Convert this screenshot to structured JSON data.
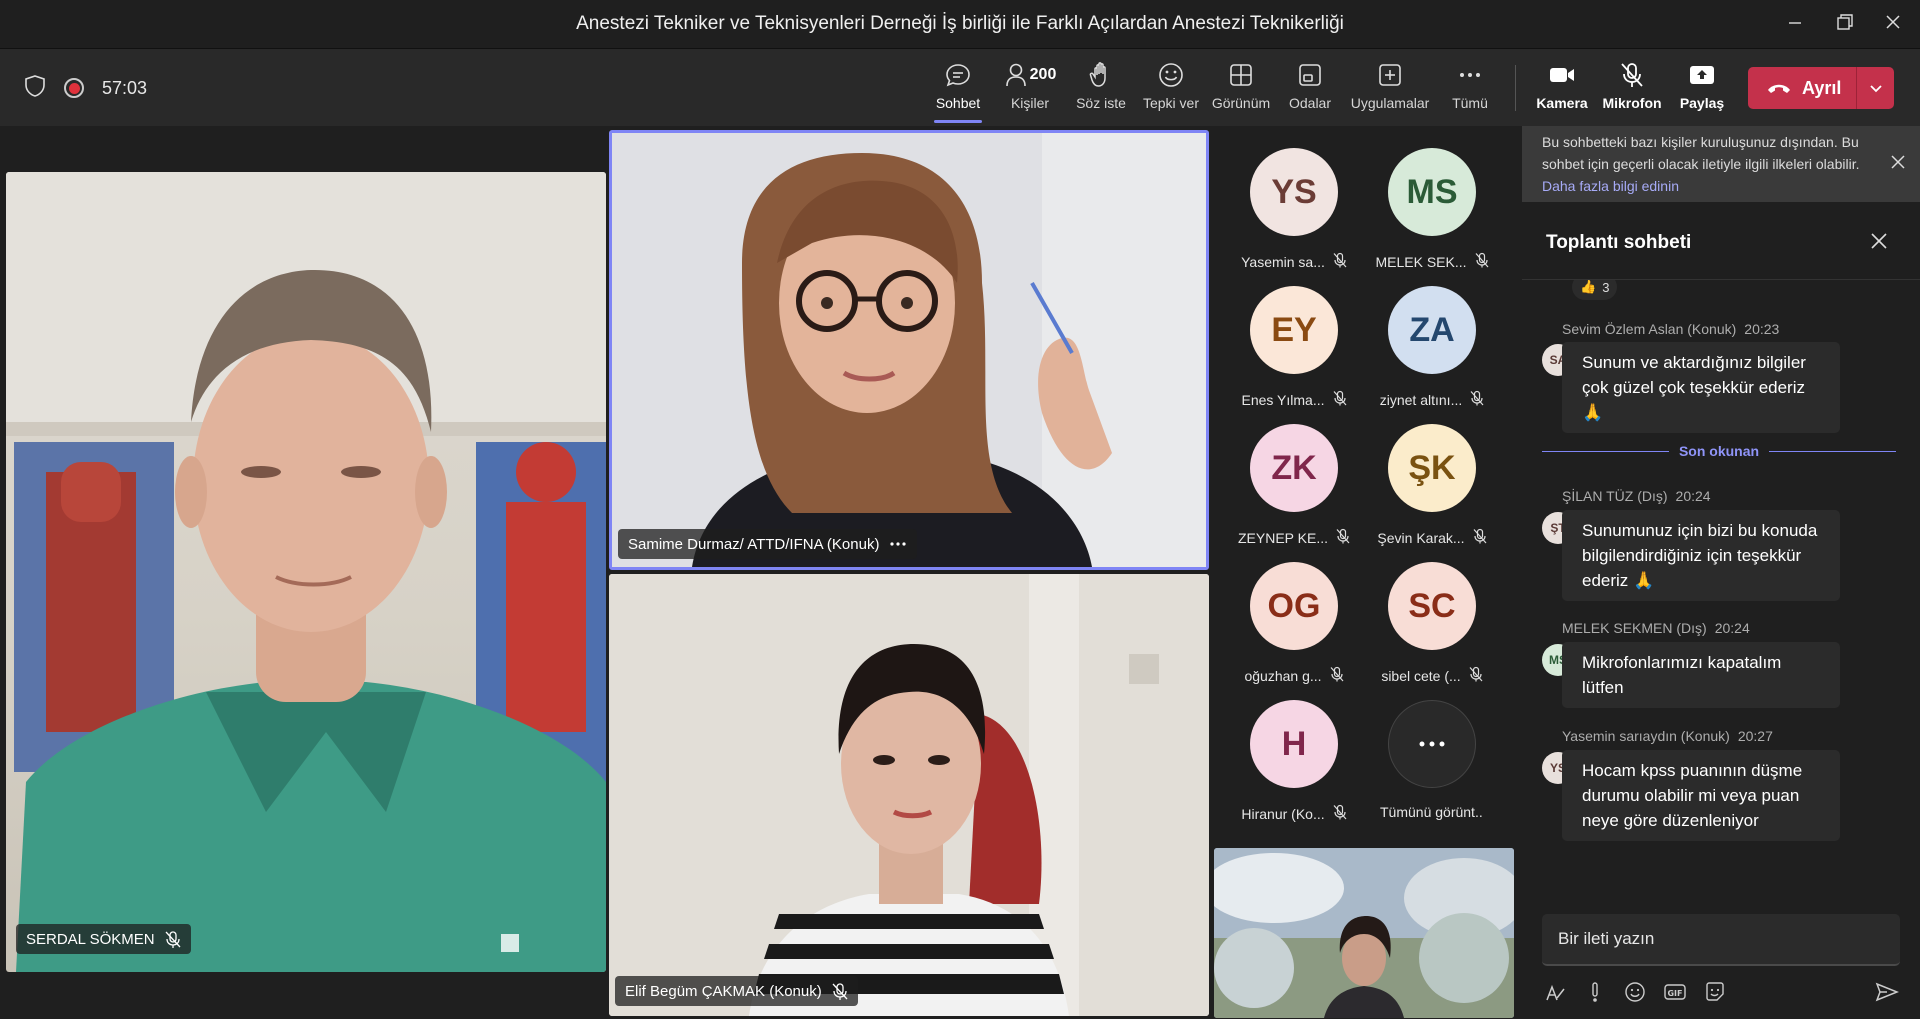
{
  "window": {
    "title": "Anestezi Tekniker ve Teknisyenleri Derneği İş birliği ile Farklı Açılardan Anestezi Teknikerliği"
  },
  "toolbar": {
    "timer": "57:03",
    "people_count": "200",
    "tools": [
      {
        "label": "Sohbet"
      },
      {
        "label": "Kişiler"
      },
      {
        "label": "Söz iste"
      },
      {
        "label": "Tepki ver"
      },
      {
        "label": "Görünüm"
      },
      {
        "label": "Odalar"
      },
      {
        "label": "Uygulamalar"
      },
      {
        "label": "Tümü"
      }
    ],
    "media": [
      {
        "label": "Kamera"
      },
      {
        "label": "Mikrofon"
      },
      {
        "label": "Paylaş"
      }
    ],
    "leave_label": "Ayrıl",
    "leave_color": "#c4314b",
    "accent_color": "#7f85f5"
  },
  "videos": [
    {
      "name": "SERDAL SÖKMEN"
    },
    {
      "name": "Samime Durmaz/ ATTD/IFNA (Konuk)"
    },
    {
      "name": "Elif Begüm ÇAKMAK (Konuk)"
    }
  ],
  "avatars": [
    {
      "initials": "YS",
      "name": "Yasemin sa...",
      "bg": "#f1e4e1",
      "fg": "#6b3c36"
    },
    {
      "initials": "MS",
      "name": "MELEK SEK...",
      "bg": "#d7ead9",
      "fg": "#2b5b37"
    },
    {
      "initials": "EY",
      "name": "Enes Yılma...",
      "bg": "#fbe7d8",
      "fg": "#8a4a12"
    },
    {
      "initials": "ZA",
      "name": "ziynet altını...",
      "bg": "#d2dff0",
      "fg": "#24476e"
    },
    {
      "initials": "ZK",
      "name": "ZEYNEP KE...",
      "bg": "#f6d6e4",
      "fg": "#80264b"
    },
    {
      "initials": "ŞK",
      "name": "Şevin Karak...",
      "bg": "#fbeccb",
      "fg": "#7a5211"
    },
    {
      "initials": "OG",
      "name": "oğuzhan g...",
      "bg": "#f8ddd6",
      "fg": "#8a2d18"
    },
    {
      "initials": "SC",
      "name": "sibel cete (...",
      "bg": "#f8ddd6",
      "fg": "#8a2d18"
    },
    {
      "initials": "H",
      "name": "Hiranur (Ko...",
      "bg": "#f6d6e4",
      "fg": "#80264b"
    },
    {
      "initials": "",
      "name": "Tümünü görünt...",
      "bg": "#292929",
      "fg": "#ffffff"
    }
  ],
  "banner": {
    "text": "Bu sohbetteki bazı kişiler kuruluşunuz dışından. Bu sohbet için geçerli olacak iletiyle ilgili ilkeleri olabilir.",
    "link": "Daha fazla bilgi edinin"
  },
  "chat": {
    "title": "Toplantı sohbeti",
    "reaction": {
      "emoji": "👍",
      "count": "3"
    },
    "divider": "Son okunan",
    "messages": [
      {
        "sender": "Sevim Özlem Aslan (Konuk)",
        "time": "20:23",
        "initials": "SA",
        "text": "Sunum ve aktardığınız bilgiler çok güzel çok teşekkür ederiz 🙏"
      },
      {
        "sender": "ŞİLAN TÜZ (Dış)",
        "time": "20:24",
        "initials": "ŞT",
        "text": "Sunumunuz için bizi bu konuda bilgilendirdiğiniz için teşekkür ederiz 🙏"
      },
      {
        "sender": "MELEK SEKMEN (Dış)",
        "time": "20:24",
        "initials": "MS",
        "text": "Mikrofonlarımızı kapatalım lütfen"
      },
      {
        "sender": "Yasemin sarıaydın (Konuk)",
        "time": "20:27",
        "initials": "YS",
        "text": "Hocam kpss puanının düşme durumu olabilir mi veya puan neye göre düzenleniyor"
      }
    ],
    "composer_placeholder": "Bir ileti yazın"
  }
}
